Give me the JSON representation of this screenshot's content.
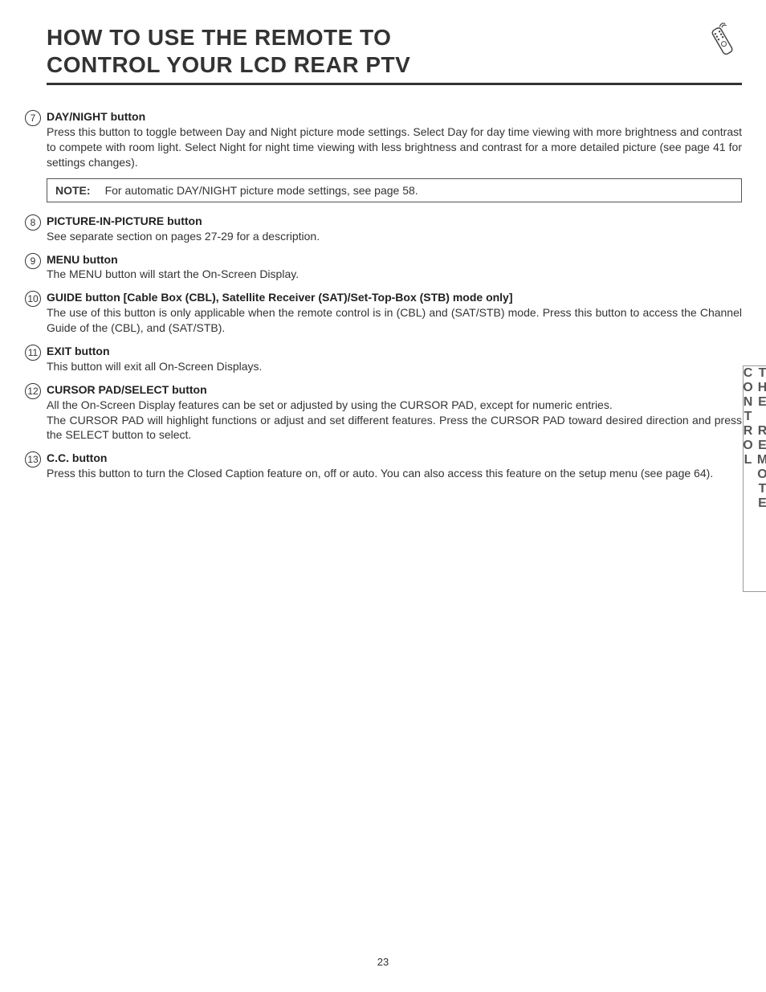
{
  "title": {
    "line1": "HOW TO USE THE REMOTE TO",
    "line2": "CONTROL YOUR LCD REAR PTV"
  },
  "side_tab": "THE REMOTE CONTROL",
  "page_number": "23",
  "note": {
    "label": "NOTE:",
    "text": "For automatic DAY/NIGHT picture mode settings, see page 58."
  },
  "items": [
    {
      "num": "7",
      "title": "DAY/NIGHT button",
      "desc": "Press this button to toggle between Day and Night picture mode settings.  Select Day for day time viewing with more brightness and contrast to compete with room light.  Select Night for night time viewing with less brightness and contrast for a more detailed picture (see page 41 for settings changes).",
      "has_note_after": true
    },
    {
      "num": "8",
      "title": "PICTURE-IN-PICTURE button",
      "desc": "See separate section on pages 27-29 for a description."
    },
    {
      "num": "9",
      "title": "MENU button",
      "desc": "The MENU button will start the On-Screen Display."
    },
    {
      "num": "10",
      "title": "GUIDE button [Cable Box (CBL), Satellite Receiver (SAT)/Set-Top-Box (STB) mode only]",
      "desc": "The use of this button is only applicable when the remote control is in (CBL) and (SAT/STB) mode.  Press this button to access the Channel Guide of the (CBL), and (SAT/STB)."
    },
    {
      "num": "11",
      "title": "EXIT button",
      "desc": "This button will exit all On-Screen Displays."
    },
    {
      "num": "12",
      "title": "CURSOR PAD/SELECT button",
      "desc": "All the On-Screen Display features can be set or adjusted by using the CURSOR PAD, except for numeric entries.\nThe CURSOR PAD will highlight functions or adjust and set different features.  Press the CURSOR PAD toward desired direction and press the SELECT button to select."
    },
    {
      "num": "13",
      "title": "C.C. button",
      "desc": "Press this button to turn the Closed Caption feature on, off or auto.  You can also access this feature on the setup menu (see page 64)."
    }
  ]
}
